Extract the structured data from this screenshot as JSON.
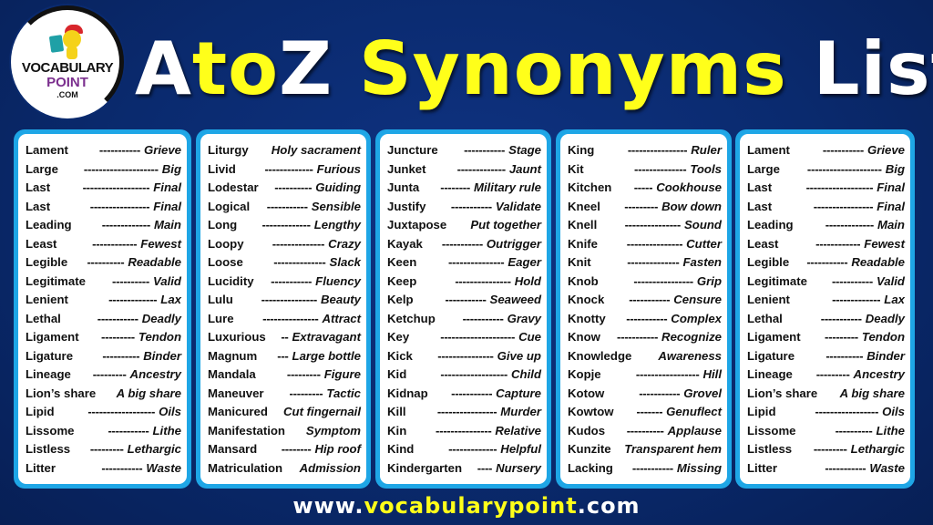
{
  "logo": {
    "line1": "VOCABULARY",
    "line2": "POINT",
    "line3": ".COM"
  },
  "title": {
    "part1": "A",
    "part2": "to",
    "part3": "Z",
    "part4": " Synonyms",
    "part5": " List"
  },
  "colors": {
    "background": "#0a2a6e",
    "panel_border": "#1ea6e6",
    "accent_yellow": "#ffff1a",
    "text_white": "#ffffff"
  },
  "columns": [
    {
      "rows": [
        {
          "word": "Lament",
          "dash": "-----------",
          "syn": "Grieve"
        },
        {
          "word": "Large",
          "dash": "--------------------",
          "syn": "Big"
        },
        {
          "word": "Last",
          "dash": "------------------",
          "syn": "Final"
        },
        {
          "word": "Last",
          "dash": "----------------",
          "syn": "Final"
        },
        {
          "word": "Leading",
          "dash": "-------------",
          "syn": "Main"
        },
        {
          "word": "Least",
          "dash": "------------",
          "syn": "Fewest"
        },
        {
          "word": "Legible",
          "dash": "----------",
          "syn": "Readable"
        },
        {
          "word": "Legitimate",
          "dash": "----------",
          "syn": "Valid"
        },
        {
          "word": "Lenient",
          "dash": "-------------",
          "syn": "Lax"
        },
        {
          "word": "Lethal",
          "dash": "-----------",
          "syn": "Deadly"
        },
        {
          "word": "Ligament",
          "dash": "---------",
          "syn": "Tendon"
        },
        {
          "word": "Ligature",
          "dash": "----------",
          "syn": "Binder"
        },
        {
          "word": "Lineage",
          "dash": "---------",
          "syn": "Ancestry"
        },
        {
          "word": "Lion’s share",
          "dash": "",
          "syn": "A big share"
        },
        {
          "word": "Lipid",
          "dash": "------------------",
          "syn": "Oils"
        },
        {
          "word": "Lissome",
          "dash": "-----------",
          "syn": "Lithe"
        },
        {
          "word": "Listless",
          "dash": "---------",
          "syn": "Lethargic"
        },
        {
          "word": "Litter",
          "dash": "-----------",
          "syn": "Waste"
        }
      ]
    },
    {
      "rows": [
        {
          "word": "Liturgy",
          "dash": "",
          "syn": "Holy sacrament"
        },
        {
          "word": "Livid",
          "dash": "-------------",
          "syn": "Furious"
        },
        {
          "word": "Lodestar",
          "dash": "----------",
          "syn": "Guiding"
        },
        {
          "word": "Logical",
          "dash": "-----------",
          "syn": "Sensible"
        },
        {
          "word": "Long",
          "dash": "-------------",
          "syn": "Lengthy"
        },
        {
          "word": "Loopy",
          "dash": "--------------",
          "syn": "Crazy"
        },
        {
          "word": "Loose",
          "dash": "--------------",
          "syn": "Slack"
        },
        {
          "word": "Lucidity",
          "dash": "-----------",
          "syn": "Fluency"
        },
        {
          "word": "Lulu",
          "dash": "---------------",
          "syn": "Beauty"
        },
        {
          "word": "Lure",
          "dash": "---------------",
          "syn": "Attract"
        },
        {
          "word": "Luxurious",
          "dash": "--",
          "syn": "Extravagant"
        },
        {
          "word": "Magnum",
          "dash": "---",
          "syn": "Large bottle"
        },
        {
          "word": "Mandala",
          "dash": "---------",
          "syn": "Figure"
        },
        {
          "word": "Maneuver",
          "dash": "---------",
          "syn": "Tactic"
        },
        {
          "word": "Manicured",
          "dash": "",
          "syn": "Cut fingernail"
        },
        {
          "word": "Manifestation",
          "dash": "",
          "syn": "Symptom"
        },
        {
          "word": "Mansard",
          "dash": "--------",
          "syn": "Hip roof"
        },
        {
          "word": "Matriculation",
          "dash": "",
          "syn": "Admission"
        }
      ]
    },
    {
      "rows": [
        {
          "word": "Juncture",
          "dash": "-----------",
          "syn": "Stage"
        },
        {
          "word": "Junket",
          "dash": "-------------",
          "syn": "Jaunt"
        },
        {
          "word": "Junta",
          "dash": "--------",
          "syn": "Military rule"
        },
        {
          "word": "Justify",
          "dash": "-----------",
          "syn": "Validate"
        },
        {
          "word": "Juxtapose",
          "dash": "",
          "syn": "Put together"
        },
        {
          "word": "Kayak",
          "dash": "-----------",
          "syn": "Outrigger"
        },
        {
          "word": "Keen",
          "dash": "---------------",
          "syn": "Eager"
        },
        {
          "word": "Keep",
          "dash": "---------------",
          "syn": "Hold"
        },
        {
          "word": "Kelp",
          "dash": "-----------",
          "syn": "Seaweed"
        },
        {
          "word": "Ketchup",
          "dash": "-----------",
          "syn": "Gravy"
        },
        {
          "word": "Key",
          "dash": "--------------------",
          "syn": "Cue"
        },
        {
          "word": "Kick",
          "dash": "---------------",
          "syn": "Give up"
        },
        {
          "word": "Kid",
          "dash": "------------------",
          "syn": "Child"
        },
        {
          "word": "Kidnap",
          "dash": "-----------",
          "syn": "Capture"
        },
        {
          "word": "Kill",
          "dash": "----------------",
          "syn": "Murder"
        },
        {
          "word": "Kin",
          "dash": "---------------",
          "syn": "Relative"
        },
        {
          "word": "Kind",
          "dash": "-------------",
          "syn": "Helpful"
        },
        {
          "word": "Kindergarten",
          "dash": "----",
          "syn": "Nursery"
        }
      ]
    },
    {
      "rows": [
        {
          "word": "King",
          "dash": "----------------",
          "syn": "Ruler"
        },
        {
          "word": "Kit",
          "dash": "--------------",
          "syn": "Tools"
        },
        {
          "word": "Kitchen",
          "dash": "-----",
          "syn": "Cookhouse"
        },
        {
          "word": "Kneel",
          "dash": "---------",
          "syn": "Bow down"
        },
        {
          "word": "Knell",
          "dash": "---------------",
          "syn": "Sound"
        },
        {
          "word": "Knife",
          "dash": "---------------",
          "syn": "Cutter"
        },
        {
          "word": "Knit",
          "dash": "--------------",
          "syn": "Fasten"
        },
        {
          "word": "Knob",
          "dash": "----------------",
          "syn": "Grip"
        },
        {
          "word": "Knock",
          "dash": "-----------",
          "syn": "Censure"
        },
        {
          "word": "Knotty",
          "dash": "-----------",
          "syn": "Complex"
        },
        {
          "word": "Know",
          "dash": "-----------",
          "syn": "Recognize"
        },
        {
          "word": "Knowledge",
          "dash": "",
          "syn": "Awareness"
        },
        {
          "word": "Kopje",
          "dash": "-----------------",
          "syn": "Hill"
        },
        {
          "word": "Kotow",
          "dash": "-----------",
          "syn": "Grovel"
        },
        {
          "word": "Kowtow",
          "dash": "-------",
          "syn": "Genuflect"
        },
        {
          "word": "Kudos",
          "dash": "----------",
          "syn": "Applause"
        },
        {
          "word": "Kunzite",
          "dash": "",
          "syn": "Transparent hem"
        },
        {
          "word": "Lacking",
          "dash": "-----------",
          "syn": "Missing"
        }
      ]
    },
    {
      "rows": [
        {
          "word": "Lament",
          "dash": "-----------",
          "syn": "Grieve"
        },
        {
          "word": "Large",
          "dash": "--------------------",
          "syn": "Big"
        },
        {
          "word": "Last",
          "dash": "------------------",
          "syn": "Final"
        },
        {
          "word": "Last",
          "dash": "----------------",
          "syn": "Final"
        },
        {
          "word": "Leading",
          "dash": "-------------",
          "syn": "Main"
        },
        {
          "word": "Least",
          "dash": "------------",
          "syn": "Fewest"
        },
        {
          "word": "Legible",
          "dash": "-----------",
          "syn": "Readable"
        },
        {
          "word": "Legitimate",
          "dash": "-----------",
          "syn": "Valid"
        },
        {
          "word": "Lenient",
          "dash": "-------------",
          "syn": "Lax"
        },
        {
          "word": "Lethal",
          "dash": "-----------",
          "syn": "Deadly"
        },
        {
          "word": "Ligament",
          "dash": "---------",
          "syn": "Tendon"
        },
        {
          "word": "Ligature",
          "dash": "----------",
          "syn": "Binder"
        },
        {
          "word": "Lineage",
          "dash": "---------",
          "syn": "Ancestry"
        },
        {
          "word": "Lion’s share",
          "dash": "",
          "syn": "A big share"
        },
        {
          "word": "Lipid",
          "dash": "-----------------",
          "syn": "Oils"
        },
        {
          "word": "Lissome",
          "dash": "----------",
          "syn": "Lithe"
        },
        {
          "word": "Listless",
          "dash": "---------",
          "syn": "Lethargic"
        },
        {
          "word": "Litter",
          "dash": "-----------",
          "syn": "Waste"
        }
      ]
    }
  ],
  "footer": {
    "part1": "www.",
    "part2": "vocabularypoint",
    "part3": ".com"
  }
}
